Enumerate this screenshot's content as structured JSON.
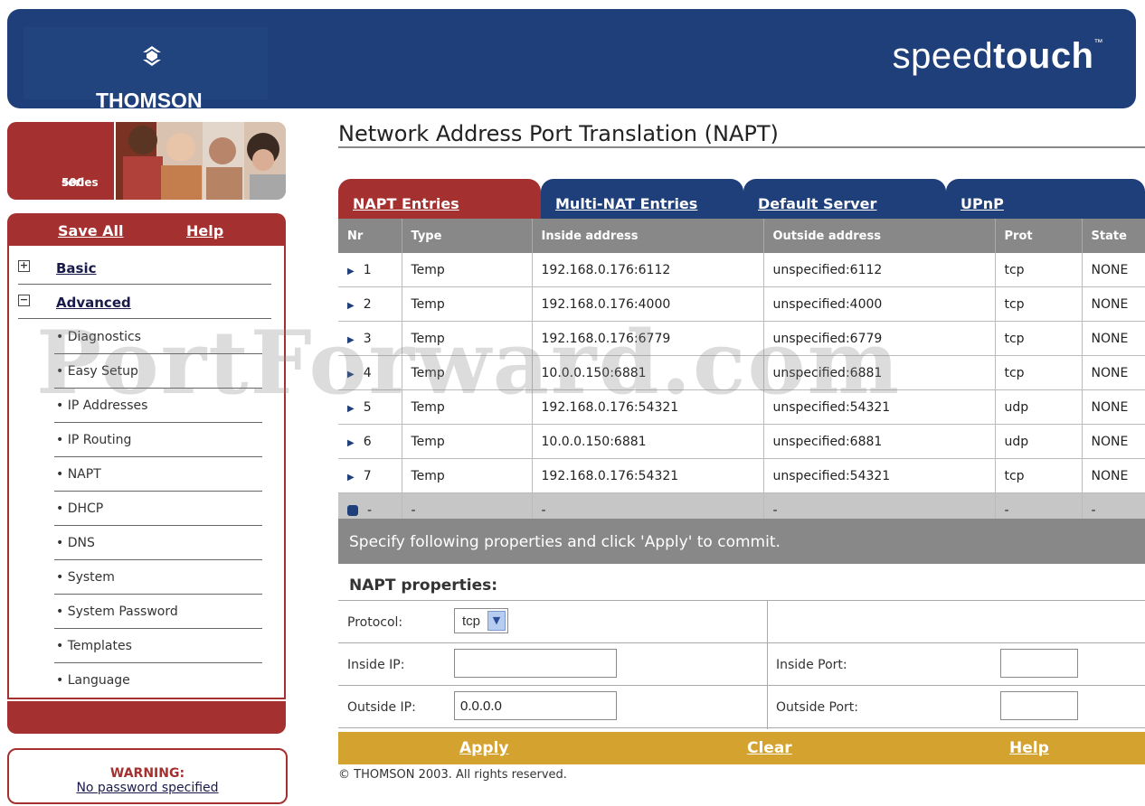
{
  "header": {
    "logo_text": "THOMSON",
    "brand_light": "speed",
    "brand_bold": "touch",
    "brand_tm": "™"
  },
  "sidebar": {
    "series_line1": "500",
    "series_line2": "series",
    "save_all": "Save All",
    "help": "Help",
    "sections": [
      {
        "label": "Basic",
        "toggle": "+"
      },
      {
        "label": "Advanced",
        "toggle": "−"
      }
    ],
    "items": [
      {
        "label": "• Diagnostics"
      },
      {
        "label": "• Easy Setup"
      },
      {
        "label": "• IP Addresses"
      },
      {
        "label": "• IP Routing"
      },
      {
        "label": "• NAPT"
      },
      {
        "label": "• DHCP"
      },
      {
        "label": "• DNS"
      },
      {
        "label": "• System"
      },
      {
        "label": "• System Password"
      },
      {
        "label": "• Templates"
      },
      {
        "label": "• Language"
      }
    ],
    "warning_title": "WARNING:",
    "warning_link": "No password specified"
  },
  "main": {
    "title": "Network Address Port Translation (NAPT)",
    "tabs": [
      {
        "label": "NAPT Entries",
        "active": true
      },
      {
        "label": "Multi-NAT Entries",
        "active": false
      },
      {
        "label": "Default Server",
        "active": false
      },
      {
        "label": "UPnP",
        "active": false
      }
    ],
    "columns": [
      "Nr",
      "Type",
      "Inside address",
      "Outside address",
      "Prot",
      "State"
    ],
    "rows": [
      {
        "nr": "1",
        "type": "Temp",
        "inside": "192.168.0.176:6112",
        "outside": "unspecified:6112",
        "prot": "tcp",
        "state": "NONE"
      },
      {
        "nr": "2",
        "type": "Temp",
        "inside": "192.168.0.176:4000",
        "outside": "unspecified:4000",
        "prot": "tcp",
        "state": "NONE"
      },
      {
        "nr": "3",
        "type": "Temp",
        "inside": "192.168.0.176:6779",
        "outside": "unspecified:6779",
        "prot": "tcp",
        "state": "NONE"
      },
      {
        "nr": "4",
        "type": "Temp",
        "inside": "10.0.0.150:6881",
        "outside": "unspecified:6881",
        "prot": "tcp",
        "state": "NONE"
      },
      {
        "nr": "5",
        "type": "Temp",
        "inside": "192.168.0.176:54321",
        "outside": "unspecified:54321",
        "prot": "udp",
        "state": "NONE"
      },
      {
        "nr": "6",
        "type": "Temp",
        "inside": "10.0.0.150:6881",
        "outside": "unspecified:6881",
        "prot": "udp",
        "state": "NONE"
      },
      {
        "nr": "7",
        "type": "Temp",
        "inside": "192.168.0.176:54321",
        "outside": "unspecified:54321",
        "prot": "tcp",
        "state": "NONE"
      }
    ],
    "new_row": {
      "nr": "-",
      "type": "-",
      "inside": "-",
      "outside": "-",
      "prot": "-",
      "state": "-"
    },
    "hint": "Specify following properties and click 'Apply' to commit.",
    "props_title": "NAPT properties:",
    "protocol_label": "Protocol:",
    "protocol_value": "tcp",
    "inside_ip_label": "Inside IP:",
    "inside_ip_value": "",
    "inside_port_label": "Inside Port:",
    "inside_port_value": "",
    "outside_ip_label": "Outside IP:",
    "outside_ip_value": "0.0.0.0",
    "outside_port_label": "Outside Port:",
    "outside_port_value": "",
    "apply": "Apply",
    "clear": "Clear",
    "help": "Help",
    "copyright": "© THOMSON 2003. All rights reserved."
  },
  "watermark": "PortForward.com",
  "colors": {
    "navy": "#1f3f7a",
    "maroon": "#a43030",
    "gold": "#d4a22e",
    "gray_header": "#888888"
  }
}
